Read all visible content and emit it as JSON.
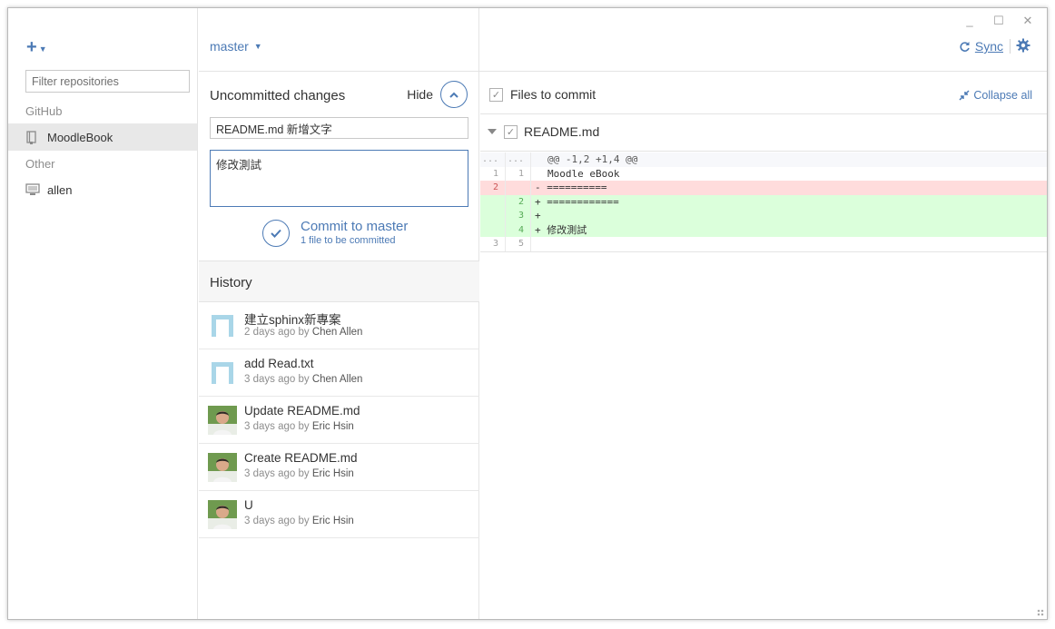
{
  "window": {
    "controls": {
      "minimize": "_",
      "maximize": "☐",
      "close": "✕"
    }
  },
  "sidebar": {
    "add_label": "+",
    "filter_placeholder": "Filter repositories",
    "github_label": "GitHub",
    "github_repos": [
      {
        "name": "MoodleBook",
        "icon": "repo-icon",
        "selected": true
      }
    ],
    "other_label": "Other",
    "other_repos": [
      {
        "name": "allen",
        "icon": "computer-icon"
      }
    ]
  },
  "toolbar": {
    "branch": "master",
    "sync_label": "Sync",
    "settings_icon": "gear-icon"
  },
  "uncommitted": {
    "title": "Uncommitted changes",
    "hide_label": "Hide",
    "summary_value": "README.md 新增文字",
    "description_value": "修改測試",
    "commit_label": "Commit to master",
    "commit_sub": "1 file to be committed"
  },
  "history": {
    "title": "History",
    "items": [
      {
        "title": "建立sphinx新專案",
        "when": "2 days ago by",
        "author": "Chen Allen",
        "avatar": "default"
      },
      {
        "title": "add Read.txt",
        "when": "3 days ago by",
        "author": "Chen Allen",
        "avatar": "default"
      },
      {
        "title": "Update README.md",
        "when": "3 days ago by",
        "author": "Eric Hsin",
        "avatar": "photo"
      },
      {
        "title": "Create README.md",
        "when": "3 days ago by",
        "author": "Eric Hsin",
        "avatar": "photo"
      },
      {
        "title": "U",
        "when": "3 days ago by",
        "author": "Eric Hsin",
        "avatar": "photo"
      }
    ]
  },
  "changes": {
    "files_to_commit_label": "Files to commit",
    "collapse_label": "Collapse all",
    "file": "README.md",
    "diff": [
      {
        "type": "hunk",
        "old": "...",
        "new": "...",
        "code": "@@ -1,2 +1,4 @@"
      },
      {
        "type": "ctx",
        "old": "1",
        "new": "1",
        "code": "Moodle eBook"
      },
      {
        "type": "del",
        "old": "2",
        "new": "",
        "code": "- =========="
      },
      {
        "type": "add",
        "old": "",
        "new": "2",
        "code": "+ ============"
      },
      {
        "type": "add",
        "old": "",
        "new": "3",
        "code": "+"
      },
      {
        "type": "add",
        "old": "",
        "new": "4",
        "code": "+ 修改測試"
      },
      {
        "type": "ctx",
        "old": "3",
        "new": "5",
        "code": ""
      }
    ]
  },
  "colors": {
    "accent": "#4c7ab5",
    "deleted_bg": "#ffdcdc",
    "added_bg": "#dbffdb"
  }
}
